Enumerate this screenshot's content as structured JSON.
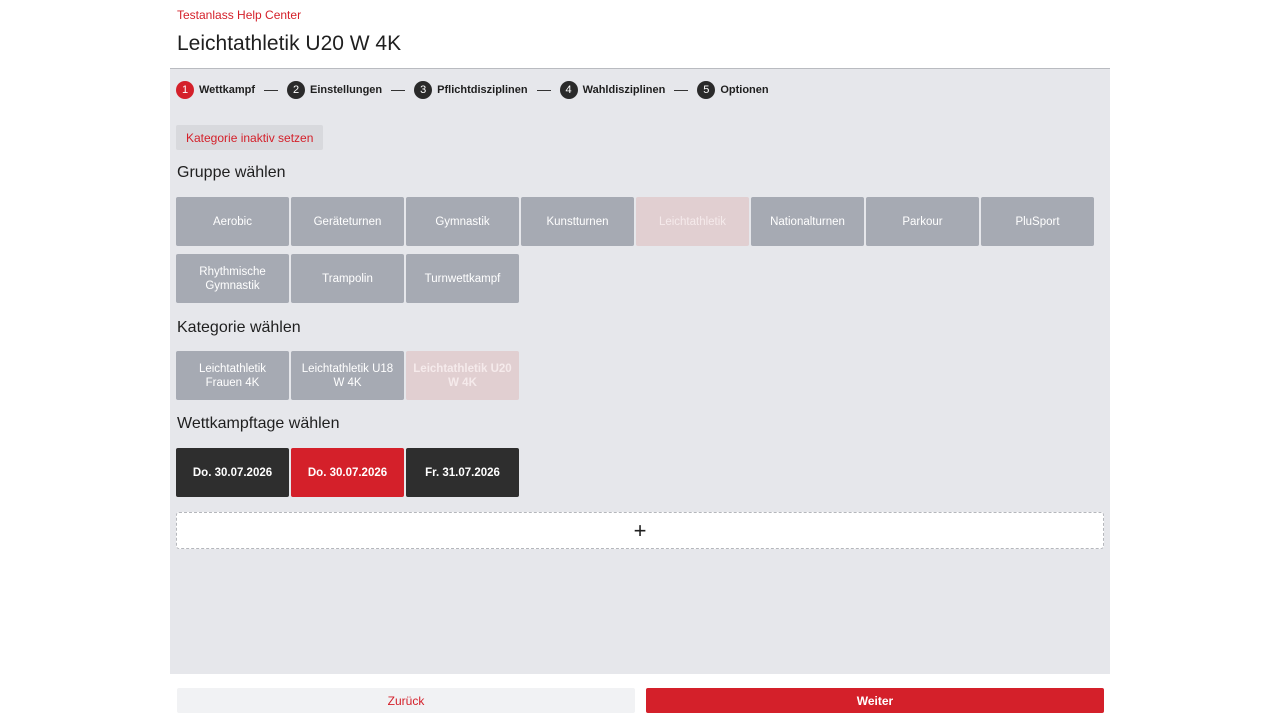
{
  "header": {
    "brand": "Testanlass Help Center",
    "title": "Leichtathletik U20 W 4K"
  },
  "stepper": [
    {
      "num": "1",
      "label": "Wettkampf",
      "active": true
    },
    {
      "num": "2",
      "label": "Einstellungen",
      "active": false
    },
    {
      "num": "3",
      "label": "Pflichtdisziplinen",
      "active": false
    },
    {
      "num": "4",
      "label": "Wahldisziplinen",
      "active": false
    },
    {
      "num": "5",
      "label": "Optionen",
      "active": false
    }
  ],
  "inactive_button": "Kategorie inaktiv setzen",
  "group": {
    "title": "Gruppe wählen",
    "items": [
      "Aerobic",
      "Geräteturnen",
      "Gymnastik",
      "Kunstturnen",
      "Leichtathletik",
      "Nationalturnen",
      "Parkour",
      "PluSport",
      "Rhythmische Gymnastik",
      "Trampolin",
      "Turnwettkampf"
    ],
    "selected": "Leichtathletik"
  },
  "category": {
    "title": "Kategorie wählen",
    "items": [
      "Leichtathletik Frauen 4K",
      "Leichtathletik U18 W 4K",
      "Leichtathletik U20 W 4K"
    ],
    "selected": "Leichtathletik U20 W 4K"
  },
  "days": {
    "title": "Wettkampftage wählen",
    "items": [
      "Do. 30.07.2026",
      "Do. 30.07.2026",
      "Fr. 31.07.2026"
    ],
    "selected_index": 1
  },
  "add_icon": "plus-icon",
  "footer": {
    "back_label": "Zurück",
    "next_label": "Weiter"
  },
  "colors": {
    "accent": "#d4202a",
    "tile": "#a6aab3",
    "tile_selected": "#e1cfd1",
    "day": "#2e2e2e",
    "panel": "#e6e7eb"
  }
}
